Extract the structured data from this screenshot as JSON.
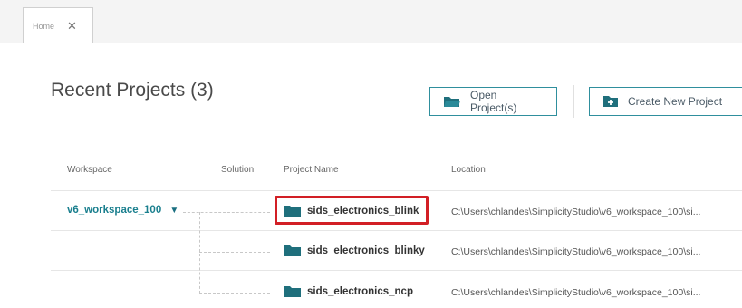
{
  "tabs": [
    {
      "label": "Home",
      "close": "✕"
    }
  ],
  "page": {
    "title": "Recent Projects (3)"
  },
  "toolbar": {
    "open_label": "Open Project(s)",
    "create_label": "Create New Project"
  },
  "table": {
    "columns": {
      "workspace": "Workspace",
      "solution": "Solution",
      "project": "Project Name",
      "location": "Location"
    },
    "workspace": {
      "name": "v6_workspace_100",
      "expand_glyph": "▼"
    },
    "rows": [
      {
        "project": "sids_electronics_blink",
        "location": "C:\\Users\\chlandes\\SimplicityStudio\\v6_workspace_100\\si..."
      },
      {
        "project": "sids_electronics_blinky",
        "location": "C:\\Users\\chlandes\\SimplicityStudio\\v6_workspace_100\\si..."
      },
      {
        "project": "sids_electronics_ncp",
        "location": "C:\\Users\\chlandes\\SimplicityStudio\\v6_workspace_100\\si..."
      }
    ]
  },
  "colors": {
    "accent": "#1a7f8e",
    "highlight": "#d21f25",
    "folder": "#1f6f7c"
  },
  "icons": {
    "folder": "folder-icon",
    "folder_open": "folder-open-icon",
    "folder_add": "folder-add-icon",
    "close": "close-icon",
    "expand": "triangle-down-icon"
  }
}
